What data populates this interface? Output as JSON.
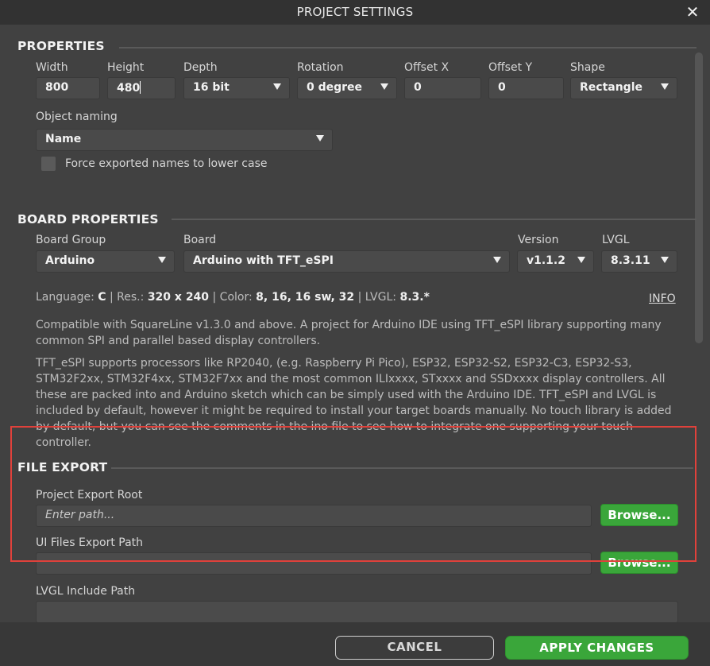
{
  "window": {
    "title": "PROJECT SETTINGS",
    "close_label": "✕"
  },
  "properties": {
    "heading": "PROPERTIES",
    "width_label": "Width",
    "width_value": "800",
    "height_label": "Height",
    "height_value": "480",
    "depth_label": "Depth",
    "depth_value": "16 bit",
    "rotation_label": "Rotation",
    "rotation_value": "0 degree",
    "offset_x_label": "Offset X",
    "offset_x_value": "0",
    "offset_y_label": "Offset Y",
    "offset_y_value": "0",
    "shape_label": "Shape",
    "shape_value": "Rectangle",
    "object_naming_label": "Object naming",
    "object_naming_value": "Name",
    "force_lowercase_label": "Force exported names to lower case",
    "force_lowercase_checked": false
  },
  "board": {
    "heading": "BOARD PROPERTIES",
    "group_label": "Board Group",
    "group_value": "Arduino",
    "board_label": "Board",
    "board_value": "Arduino with TFT_eSPI",
    "version_label": "Version",
    "version_value": "v1.1.2",
    "lvgl_label": "LVGL",
    "lvgl_value": "8.3.11",
    "info_link": "INFO",
    "spec": {
      "language_label": "Language:",
      "language_value": "C",
      "res_label": "Res.:",
      "res_value": "320 x 240",
      "color_label": "Color:",
      "color_value": "8, 16, 16 sw, 32",
      "lvgl_label": "LVGL:",
      "lvgl_value": "8.3.*",
      "sep": "|"
    },
    "description_1": "Compatible with SquareLine v1.3.0 and above. A project for Arduino IDE using TFT_eSPI library supporting many common SPI and parallel based display controllers.",
    "description_2": "TFT_eSPI supports processors like RP2040, (e.g. Raspberry Pi Pico), ESP32, ESP32-S2, ESP32-C3, ESP32-S3, STM32F2xx, STM32F4xx, STM32F7xx and the most common ILIxxxx, STxxxx and SSDxxxx display controllers. All these are packed into and Arduino sketch which can be simply used with the Arduino IDE. TFT_eSPI and LVGL is included by default, however it might be required to install your target boards manually.  No touch library is added by default, but you can see the comments in the ino file to see how to integrate one supporting your touch controller."
  },
  "file_export": {
    "heading": "FILE EXPORT",
    "project_root_label": "Project Export Root",
    "project_root_placeholder": "Enter path...",
    "ui_files_label": "UI Files Export Path",
    "ui_files_value": "",
    "browse_label": "Browse...",
    "lvgl_include_label": "LVGL Include Path",
    "lvgl_include_value": ""
  },
  "footer": {
    "cancel_label": "CANCEL",
    "apply_label": "APPLY CHANGES"
  },
  "colors": {
    "accent_green": "#3aa63a",
    "highlight_red": "#e0413b"
  },
  "icons": {
    "close": "close-icon",
    "dropdown": "chevron-down-icon"
  }
}
